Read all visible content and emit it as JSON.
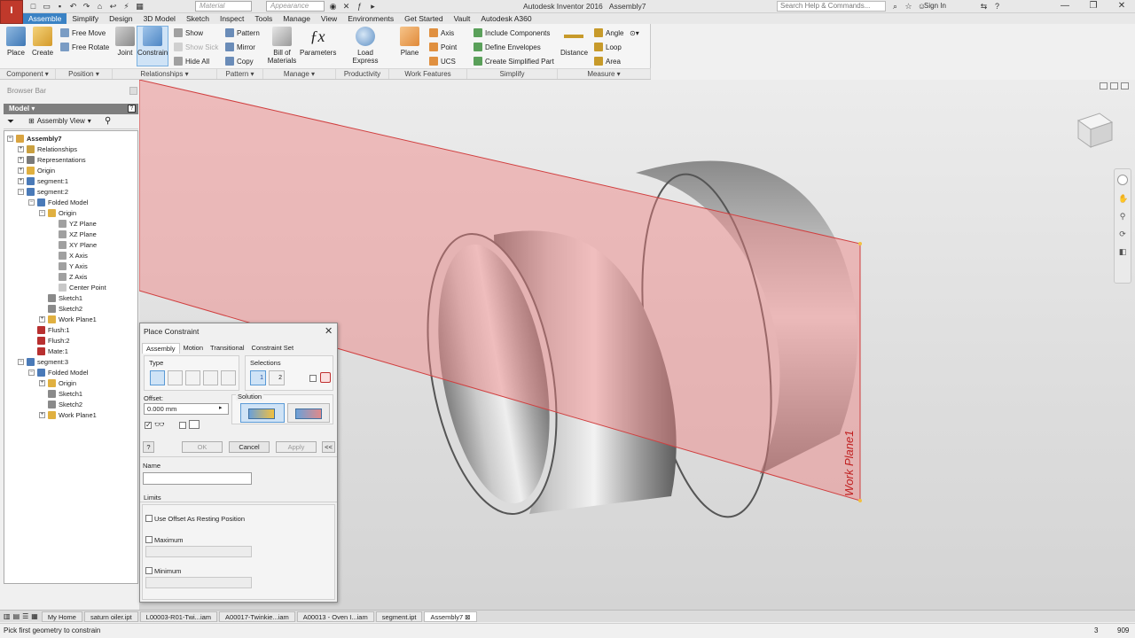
{
  "app": {
    "title": "Autodesk Inventor 2016",
    "document": "Assembly7",
    "menu_letter": "I",
    "material_placeholder": "Material",
    "appearance_placeholder": "Appearance",
    "search_placeholder": "Search Help & Commands...",
    "signin": "Sign In"
  },
  "tabs": [
    "Assemble",
    "Simplify",
    "Design",
    "3D Model",
    "Sketch",
    "Inspect",
    "Tools",
    "Manage",
    "View",
    "Environments",
    "Get Started",
    "Vault",
    "Autodesk A360"
  ],
  "ribbon": {
    "place": "Place",
    "create": "Create",
    "free_move": "Free Move",
    "free_rotate": "Free Rotate",
    "joint": "Joint",
    "constrain": "Constrain",
    "show": "Show",
    "show_sick": "Show Sick",
    "hide_all": "Hide All",
    "pattern": "Pattern",
    "mirror": "Mirror",
    "copy": "Copy",
    "bill_of_materials_1": "Bill of",
    "bill_of_materials_2": "Materials",
    "parameters": "Parameters",
    "load_express": "Load Express",
    "plane": "Plane",
    "axis": "Axis",
    "point": "Point",
    "ucs": "UCS",
    "include_components": "Include Components",
    "define_envelopes": "Define Envelopes",
    "create_simplified_part": "Create Simplified Part",
    "distance": "Distance",
    "angle": "Angle",
    "loop": "Loop",
    "area": "Area",
    "panels": [
      {
        "label": "Component ▾",
        "w": 63
      },
      {
        "label": "Position ▾",
        "w": 64
      },
      {
        "label": "Relationships ▾",
        "w": 118
      },
      {
        "label": "Pattern ▾",
        "w": 52
      },
      {
        "label": "Manage ▾",
        "w": 82
      },
      {
        "label": "Productivity",
        "w": 60
      },
      {
        "label": "Work Features",
        "w": 88
      },
      {
        "label": "Simplify",
        "w": 102
      },
      {
        "label": "Measure ▾",
        "w": 105
      }
    ]
  },
  "browser": {
    "bar": "Browser Bar",
    "head": "Model ▾",
    "view": "Assembly View",
    "tree": [
      {
        "label": "Assembly7",
        "indent": 0,
        "exp": "−",
        "color": "#d9a441",
        "bold": true
      },
      {
        "label": "Relationships",
        "indent": 1,
        "exp": "+",
        "color": "#c9a040"
      },
      {
        "label": "Representations",
        "indent": 1,
        "exp": "+",
        "color": "#7a7a7a"
      },
      {
        "label": "Origin",
        "indent": 1,
        "exp": "+",
        "color": "#e0b040"
      },
      {
        "label": "segment:1",
        "indent": 1,
        "exp": "+",
        "color": "#4a7ab8"
      },
      {
        "label": "segment:2",
        "indent": 1,
        "exp": "−",
        "color": "#4a7ab8"
      },
      {
        "label": "Folded Model",
        "indent": 2,
        "exp": "−",
        "color": "#4a7ab8"
      },
      {
        "label": "Origin",
        "indent": 3,
        "exp": "−",
        "color": "#e0b040"
      },
      {
        "label": "YZ Plane",
        "indent": 4,
        "exp": "",
        "color": "#a0a0a0"
      },
      {
        "label": "XZ Plane",
        "indent": 4,
        "exp": "",
        "color": "#a0a0a0"
      },
      {
        "label": "XY Plane",
        "indent": 4,
        "exp": "",
        "color": "#a0a0a0"
      },
      {
        "label": "X Axis",
        "indent": 4,
        "exp": "",
        "color": "#a0a0a0"
      },
      {
        "label": "Y Axis",
        "indent": 4,
        "exp": "",
        "color": "#a0a0a0"
      },
      {
        "label": "Z Axis",
        "indent": 4,
        "exp": "",
        "color": "#a0a0a0"
      },
      {
        "label": "Center Point",
        "indent": 4,
        "exp": "",
        "color": "#c8c8c8"
      },
      {
        "label": "Sketch1",
        "indent": 3,
        "exp": "",
        "color": "#8a8a8a"
      },
      {
        "label": "Sketch2",
        "indent": 3,
        "exp": "",
        "color": "#8a8a8a"
      },
      {
        "label": "Work Plane1",
        "indent": 3,
        "exp": "+",
        "color": "#e0b040"
      },
      {
        "label": "Flush:1",
        "indent": 2,
        "exp": "",
        "color": "#b83030"
      },
      {
        "label": "Flush:2",
        "indent": 2,
        "exp": "",
        "color": "#b83030"
      },
      {
        "label": "Mate:1",
        "indent": 2,
        "exp": "",
        "color": "#b83030"
      },
      {
        "label": "segment:3",
        "indent": 1,
        "exp": "−",
        "color": "#4a7ab8"
      },
      {
        "label": "Folded Model",
        "indent": 2,
        "exp": "−",
        "color": "#4a7ab8"
      },
      {
        "label": "Origin",
        "indent": 3,
        "exp": "+",
        "color": "#e0b040"
      },
      {
        "label": "Sketch1",
        "indent": 3,
        "exp": "",
        "color": "#8a8a8a"
      },
      {
        "label": "Sketch2",
        "indent": 3,
        "exp": "",
        "color": "#8a8a8a"
      },
      {
        "label": "Work Plane1",
        "indent": 3,
        "exp": "+",
        "color": "#e0b040"
      }
    ]
  },
  "viewport": {
    "work_plane_label": "Work Plane1"
  },
  "dialog": {
    "title": "Place Constraint",
    "tabs": [
      "Assembly",
      "Motion",
      "Transitional",
      "Constraint Set"
    ],
    "type_label": "Type",
    "selections_label": "Selections",
    "sel1": "1",
    "sel2": "2",
    "offset_label": "Offset:",
    "offset_value": "0.000 mm",
    "solution_label": "Solution",
    "ok": "OK",
    "cancel": "Cancel",
    "apply": "Apply",
    "expand": "<<",
    "help": "?",
    "name_label": "Name",
    "name_value": "",
    "limits_label": "Limits",
    "use_offset": "Use Offset As Resting Position",
    "maximum": "Maximum",
    "minimum": "Minimum"
  },
  "doc_tabs": [
    "My Home",
    "saturn oiler.ipt",
    "L00003-R01-Twi...iam",
    "A00017-Twinkie...iam",
    "A00013 - Oven I...iam",
    "segment.ipt",
    "Assembly7"
  ],
  "status": {
    "message": "Pick first geometry to constrain",
    "count1": "3",
    "count2": "909"
  }
}
